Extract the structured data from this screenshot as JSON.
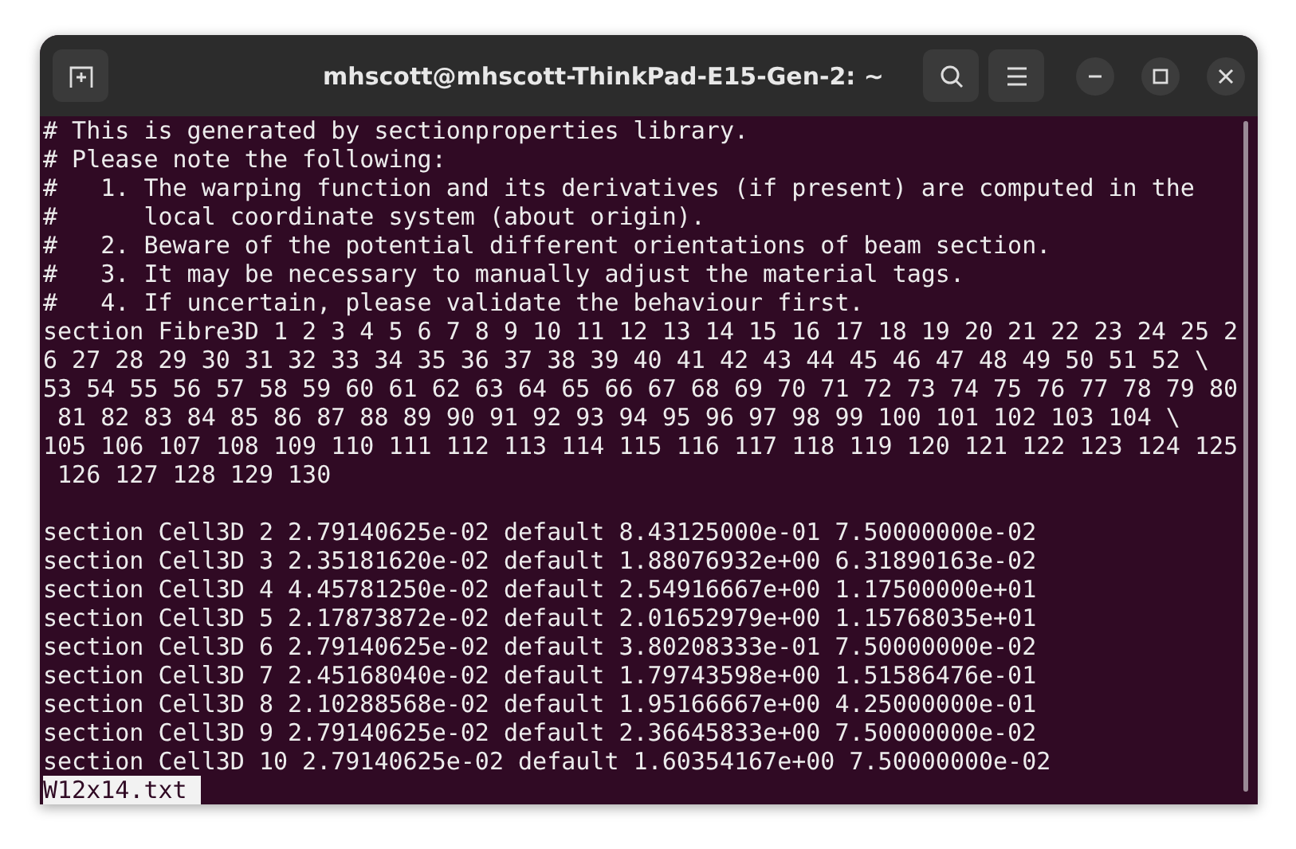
{
  "window": {
    "title": "mhscott@mhscott-ThinkPad-E15-Gen-2: ~"
  },
  "terminal": {
    "blocks": [
      [
        "# This is generated by sectionproperties library.",
        "# Please note the following:",
        "#   1. The warping function and its derivatives (if present) are computed in the",
        "#      local coordinate system (about origin).",
        "#   2. Beware of the potential different orientations of beam section.",
        "#   3. It may be necessary to manually adjust the material tags.",
        "#   4. If uncertain, please validate the behaviour first.",
        "section Fibre3D 1 2 3 4 5 6 7 8 9 10 11 12 13 14 15 16 17 18 19 20 21 22 23 24 25 2",
        "6 27 28 29 30 31 32 33 34 35 36 37 38 39 40 41 42 43 44 45 46 47 48 49 50 51 52 \\",
        "53 54 55 56 57 58 59 60 61 62 63 64 65 66 67 68 69 70 71 72 73 74 75 76 77 78 79 80",
        " 81 82 83 84 85 86 87 88 89 90 91 92 93 94 95 96 97 98 99 100 101 102 103 104 \\",
        "105 106 107 108 109 110 111 112 113 114 115 116 117 118 119 120 121 122 123 124 125",
        " 126 127 128 129 130"
      ],
      [
        "section Cell3D 2 2.79140625e-02 default 8.43125000e-01 7.50000000e-02",
        "section Cell3D 3 2.35181620e-02 default 1.88076932e+00 6.31890163e-02",
        "section Cell3D 4 4.45781250e-02 default 2.54916667e+00 1.17500000e+01",
        "section Cell3D 5 2.17873872e-02 default 2.01652979e+00 1.15768035e+01",
        "section Cell3D 6 2.79140625e-02 default 3.80208333e-01 7.50000000e-02",
        "section Cell3D 7 2.45168040e-02 default 1.79743598e+00 1.51586476e-01",
        "section Cell3D 8 2.10288568e-02 default 1.95166667e+00 4.25000000e-01",
        "section Cell3D 9 2.79140625e-02 default 2.36645833e+00 7.50000000e-02",
        "section Cell3D 10 2.79140625e-02 default 1.60354167e+00 7.50000000e-02"
      ]
    ],
    "prompt": "W12x14.txt"
  }
}
